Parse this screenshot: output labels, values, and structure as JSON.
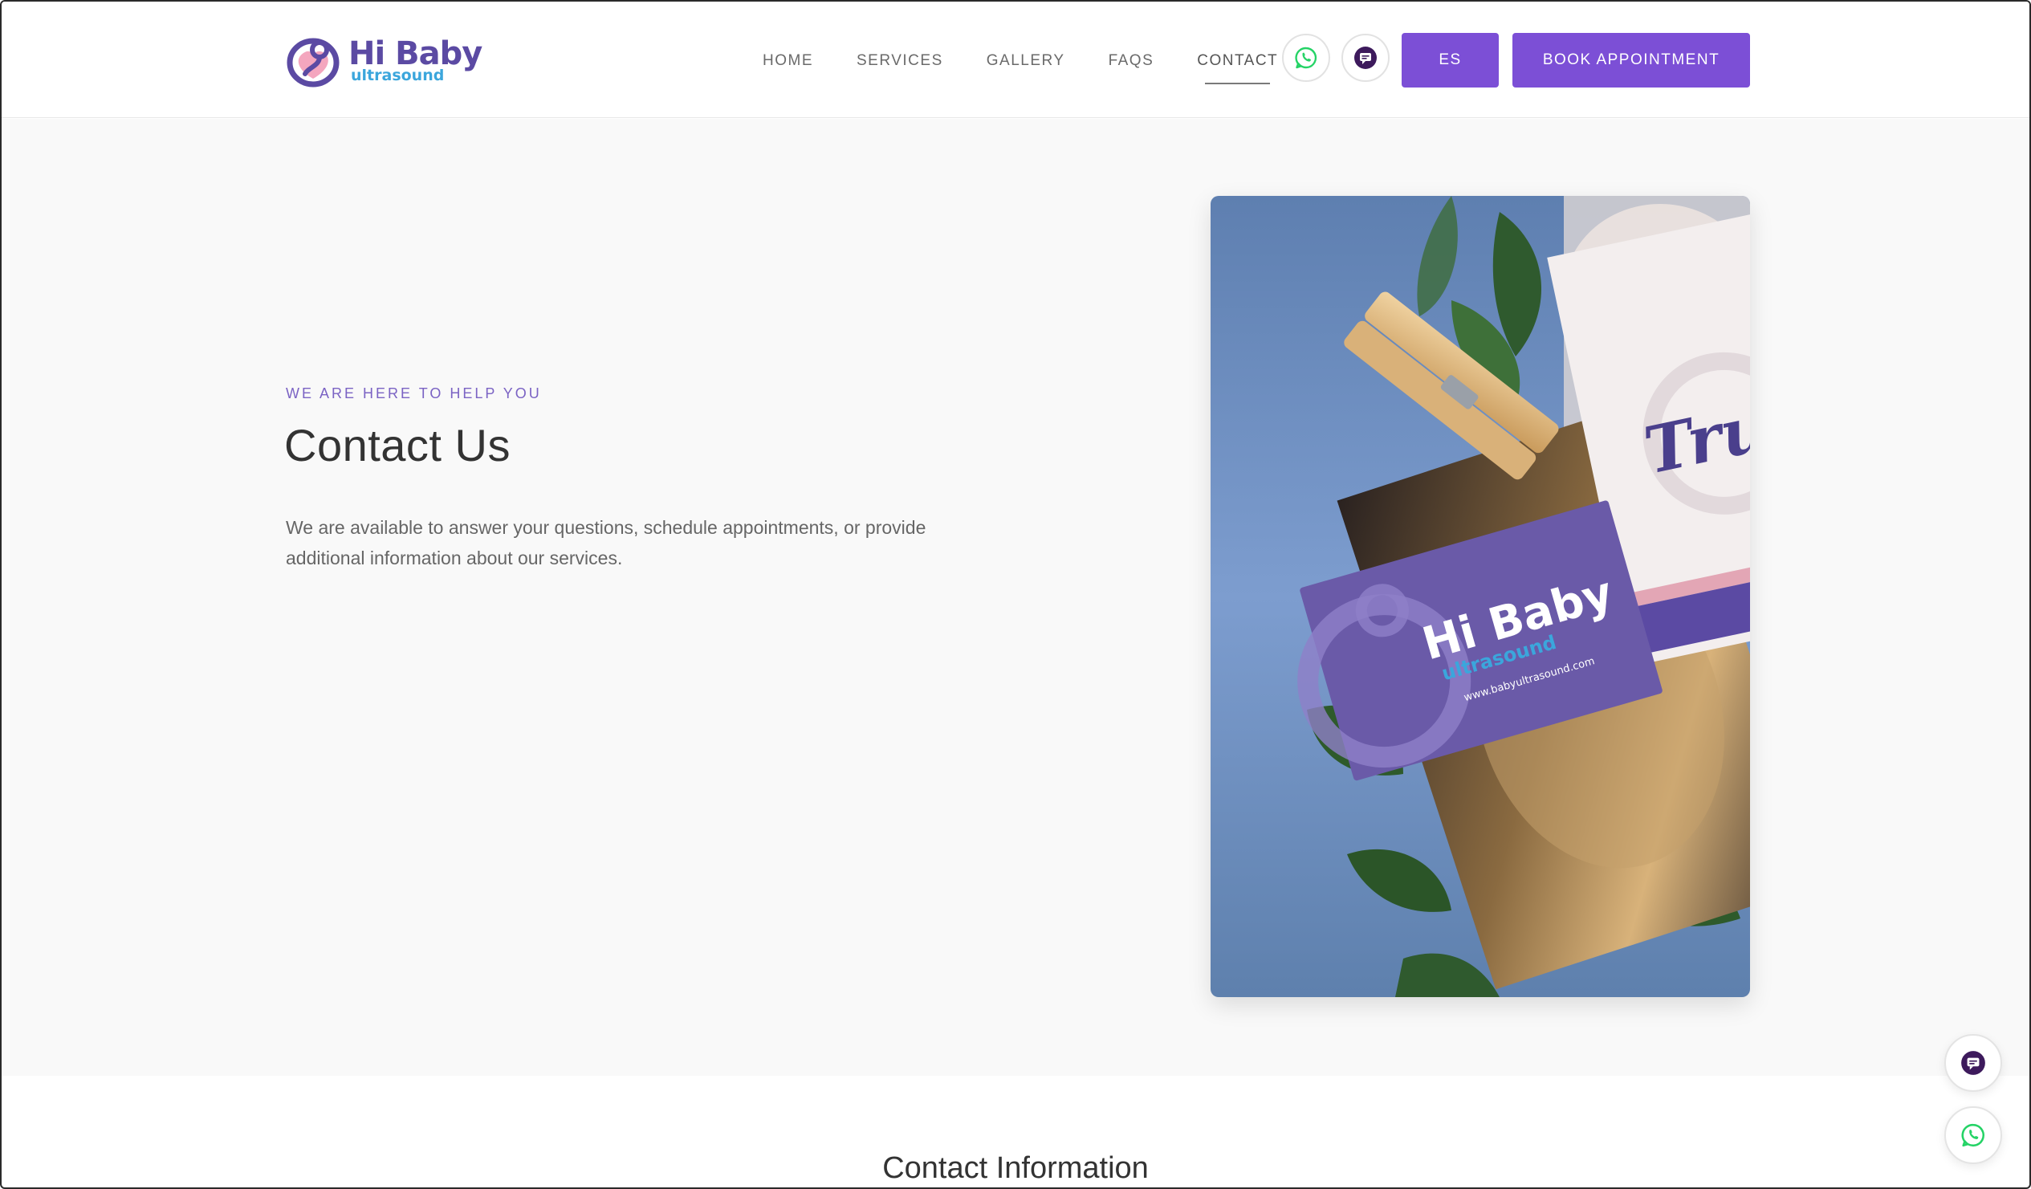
{
  "brand": {
    "name": "Hi Baby",
    "tagline": "ultrasound",
    "colors": {
      "primary": "#7c4fd6",
      "logo_purple": "#5b4aa3",
      "logo_blue": "#3ba6dc",
      "whatsapp": "#25d366",
      "chat": "#3d1a5c"
    }
  },
  "nav": {
    "items": [
      {
        "label": "HOME"
      },
      {
        "label": "SERVICES"
      },
      {
        "label": "GALLERY"
      },
      {
        "label": "FAQS"
      },
      {
        "label": "CONTACT",
        "active": true
      }
    ],
    "whatsapp_icon": "whatsapp-icon",
    "chat_icon": "chat-icon",
    "language_button": "ES",
    "book_button": "BOOK APPOINTMENT"
  },
  "hero": {
    "eyebrow": "WE ARE HERE TO HELP YOU",
    "title": "Contact Us",
    "description": "We are available to answer your questions, schedule appointments, or provide additional information about our services.",
    "image": {
      "card_brand": "Hi Baby",
      "card_sub": "ultrasound",
      "card_url": "www.babyultrasound.com",
      "script_text": "Tru"
    }
  },
  "contact_info": {
    "title": "Contact Information"
  },
  "floating": {
    "chat_icon": "chat-icon",
    "whatsapp_icon": "whatsapp-icon"
  }
}
